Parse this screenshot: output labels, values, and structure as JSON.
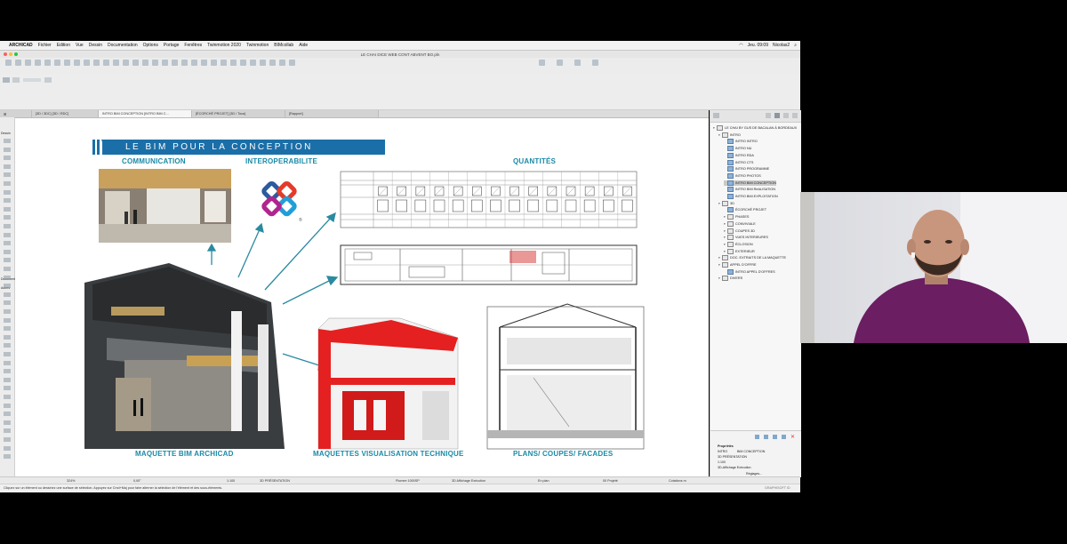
{
  "menubar": {
    "app": "ARCHICAD",
    "items": [
      "Fichier",
      "Edition",
      "Vue",
      "Dessin",
      "Documentation",
      "Options",
      "Portage",
      "Fenêtres",
      "Twinmotion 2020",
      "Twinmotion",
      "BIMcollab",
      "Aide"
    ],
    "clock": "Jeu. 09:09",
    "user": "Nicolas2"
  },
  "window": {
    "title": "LE CHAI DICE WEB CONT ABVENT BO.pln"
  },
  "tabs": [
    {
      "label": "[3D / 3DC] [3D / RDC]"
    },
    {
      "label": "INTRO BIM CONCEPTION [INTRO BIM C..."
    },
    {
      "label": "[ÉCORCHÉ PROJET] [3D / Tous]"
    },
    {
      "label": "[Rapport]"
    }
  ],
  "toolbox": {
    "labels": [
      "Dessin",
      "Document",
      "Autres"
    ]
  },
  "slide": {
    "banner": "LE BIM POUR LA CONCEPTION",
    "communication": "COMMUNICATION",
    "interoperabilite": "INTEROPERABILITE",
    "quantites": "QUANTITÉS",
    "maquette_bim": "MAQUETTE BIM ARCHICAD",
    "maquettes_visu": "MAQUETTES VISUALISATION TECHNIQUE",
    "plans": "PLANS/ COUPES/ FACADES"
  },
  "navigator": {
    "items": [
      {
        "label": "LE CHAI BY GUS DE BACALAN À BORDEAUX",
        "level": 0,
        "type": "folder"
      },
      {
        "label": "INTRO",
        "level": 1,
        "type": "folder"
      },
      {
        "label": "INTRO INTRO",
        "level": 2,
        "type": "view"
      },
      {
        "label": "INTRO NU",
        "level": 2,
        "type": "view"
      },
      {
        "label": "INTRO RDA",
        "level": 2,
        "type": "view"
      },
      {
        "label": "INTRO CTS",
        "level": 2,
        "type": "view"
      },
      {
        "label": "INTRO PROGRAMME",
        "level": 2,
        "type": "view"
      },
      {
        "label": "INTRO PHOTOS",
        "level": 2,
        "type": "view"
      },
      {
        "label": "INTRO BIM CONCEPTION",
        "level": 2,
        "type": "view",
        "selected": true
      },
      {
        "label": "INTRO BIM RéALISATION",
        "level": 2,
        "type": "view"
      },
      {
        "label": "INTRO BIM EXPLOITATION",
        "level": 2,
        "type": "view"
      },
      {
        "label": "3D",
        "level": 1,
        "type": "folder"
      },
      {
        "label": "ÉCORCHÉ PROJET",
        "level": 2,
        "type": "view"
      },
      {
        "label": "PHASES",
        "level": 2,
        "type": "folder"
      },
      {
        "label": "CONVIVIALE",
        "level": 2,
        "type": "folder"
      },
      {
        "label": "COUPES 3D",
        "level": 2,
        "type": "folder"
      },
      {
        "label": "VUES INTERIEURES",
        "level": 2,
        "type": "folder"
      },
      {
        "label": "ÉCLOSION",
        "level": 2,
        "type": "folder"
      },
      {
        "label": "EXTERIEUR",
        "level": 2,
        "type": "folder"
      },
      {
        "label": "DOC. EXTRAITS DE LA MAQUETTE",
        "level": 1,
        "type": "folder"
      },
      {
        "label": "APPEL D'OFFRE",
        "level": 1,
        "type": "folder"
      },
      {
        "label": "INTRO APPEL D'OFFRES",
        "level": 2,
        "type": "view"
      },
      {
        "label": "DIVERS",
        "level": 1,
        "type": "folder"
      }
    ]
  },
  "properties": {
    "header": "Propriétés",
    "id": "INTRO",
    "name": "BIM CONCEPTION",
    "layer": "3D PRÉSENTATION",
    "scale": "1:100",
    "view": "3D-Affichage Exécution",
    "more": "Réglages..."
  },
  "statusbar": {
    "zoom": "324%",
    "angle": "0,00°",
    "scale": "1:100",
    "layer": "3D PRÉSENTATION",
    "graphic": "Plomee 1000SP",
    "model": "3D Affichage Exécution",
    "structure": "En plan",
    "renovation": "00 Projeté",
    "cotation": "Cotations m",
    "graphisoft": "GRAPHISOFT ID"
  },
  "hint": "Cliquez sur un élément ou dessinez une surface de sélection. Appuyez sur Cmd+Maj pour faire alterner la sélection de l'élément et des sous-éléments."
}
